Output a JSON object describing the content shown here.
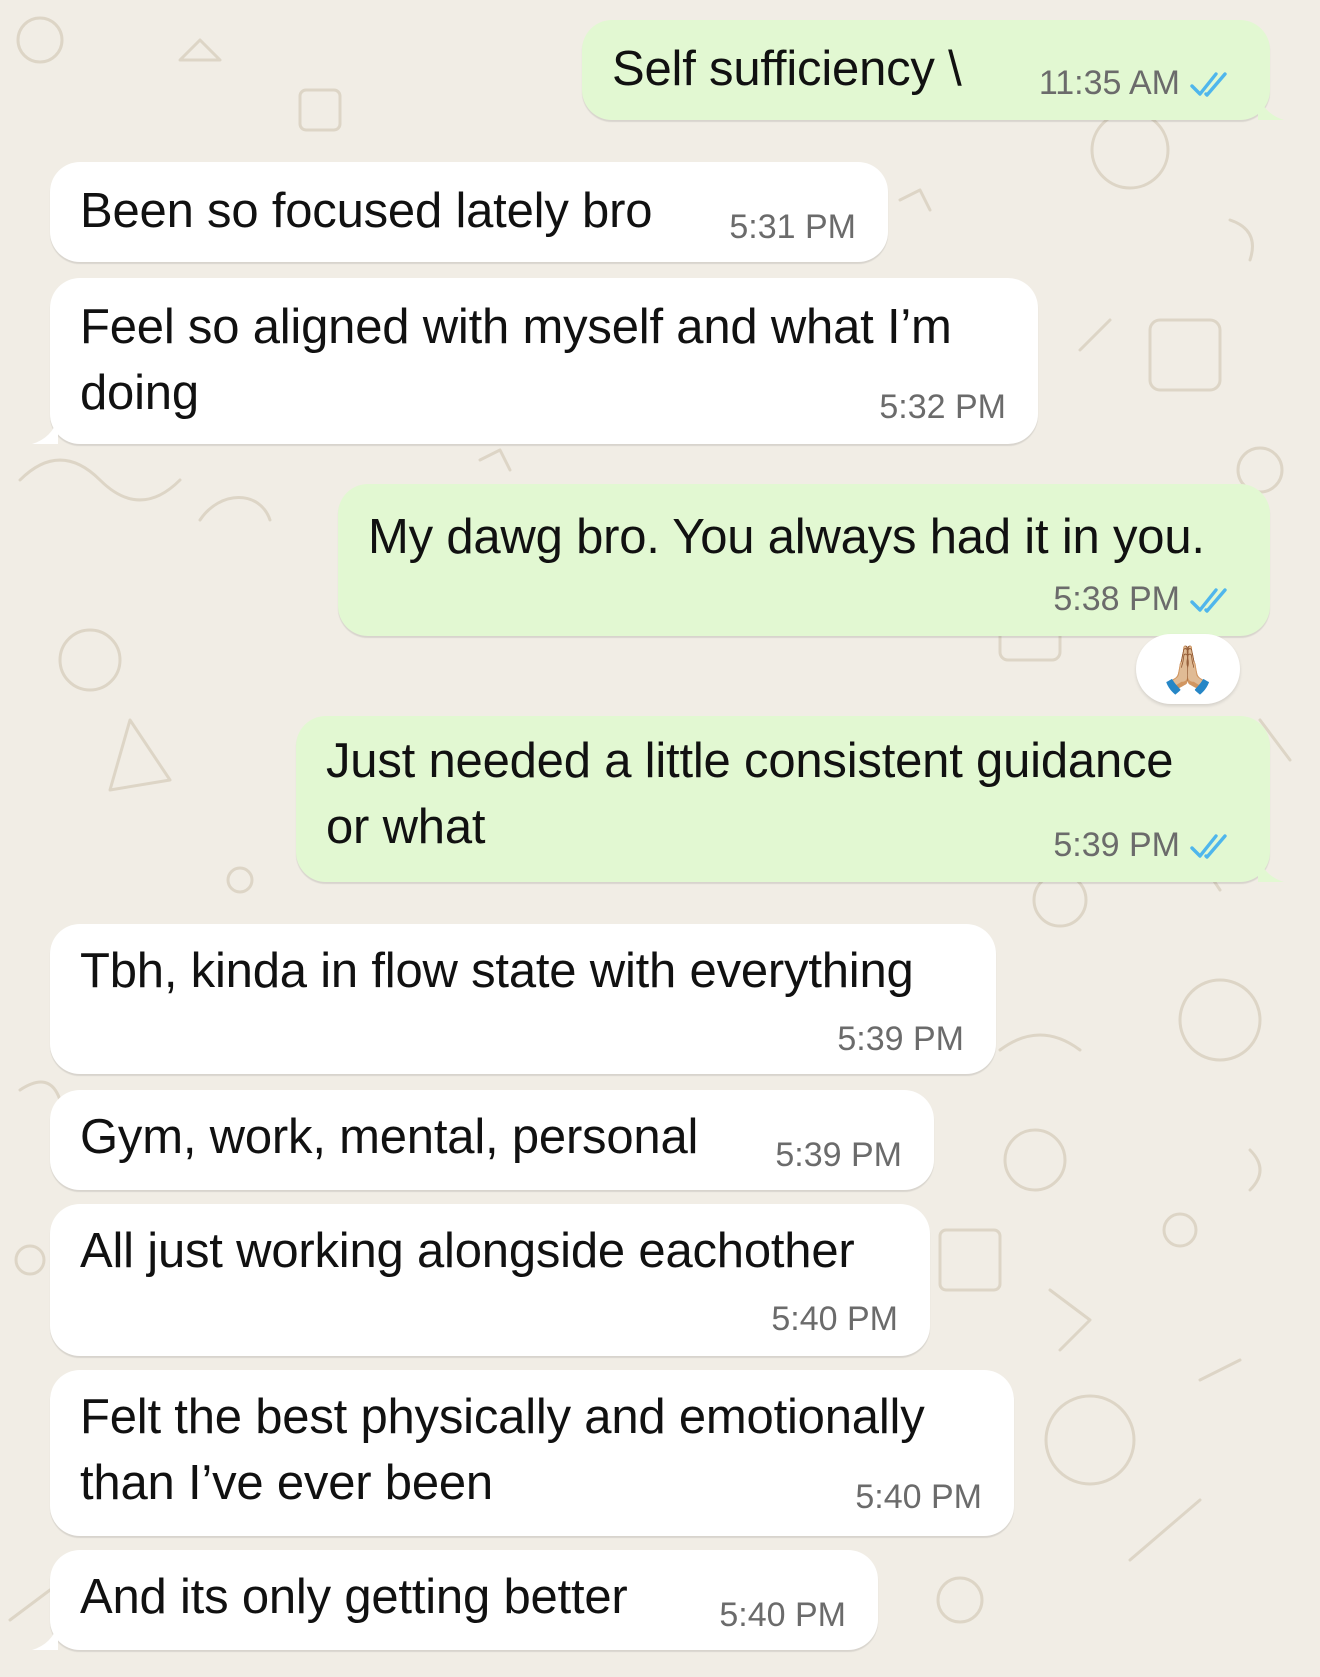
{
  "messages": [
    {
      "id": "m1",
      "direction": "outgoing",
      "text": "Self sufficiency \\",
      "time": "11:35 AM",
      "status": "read"
    },
    {
      "id": "m2",
      "direction": "incoming",
      "text": "Been so focused lately bro",
      "time": "5:31 PM"
    },
    {
      "id": "m3",
      "direction": "incoming",
      "lines": [
        "Feel so aligned with myself and what I’m",
        "doing"
      ],
      "time": "5:32 PM"
    },
    {
      "id": "m4",
      "direction": "outgoing",
      "text": "My dawg bro. You always had it in you.",
      "time": "5:38 PM",
      "status": "read",
      "reaction": "🙏🏼"
    },
    {
      "id": "m5",
      "direction": "outgoing",
      "lines": [
        "Just needed a little consistent guidance",
        "or what"
      ],
      "time": "5:39 PM",
      "status": "read"
    },
    {
      "id": "m6",
      "direction": "incoming",
      "text": "Tbh, kinda in flow state with everything",
      "time": "5:39 PM"
    },
    {
      "id": "m7",
      "direction": "incoming",
      "text": "Gym, work, mental, personal",
      "time": "5:39 PM"
    },
    {
      "id": "m8",
      "direction": "incoming",
      "text": "All just working alongside eachother",
      "time": "5:40 PM"
    },
    {
      "id": "m9",
      "direction": "incoming",
      "lines": [
        "Felt the best physically and emotionally",
        "than I’ve ever been"
      ],
      "time": "5:40 PM"
    },
    {
      "id": "m10",
      "direction": "incoming",
      "text": "And its only getting better",
      "time": "5:40 PM"
    }
  ],
  "colors": {
    "background": "#f1ede5",
    "incoming_bubble": "#ffffff",
    "outgoing_bubble": "#dcf8c6",
    "read_tick": "#4fb6ec",
    "timestamp": "#6b6b6b",
    "text": "#111111"
  },
  "icons": {
    "read_receipt": "double-check-icon",
    "wallpaper": "doodle-pattern"
  }
}
